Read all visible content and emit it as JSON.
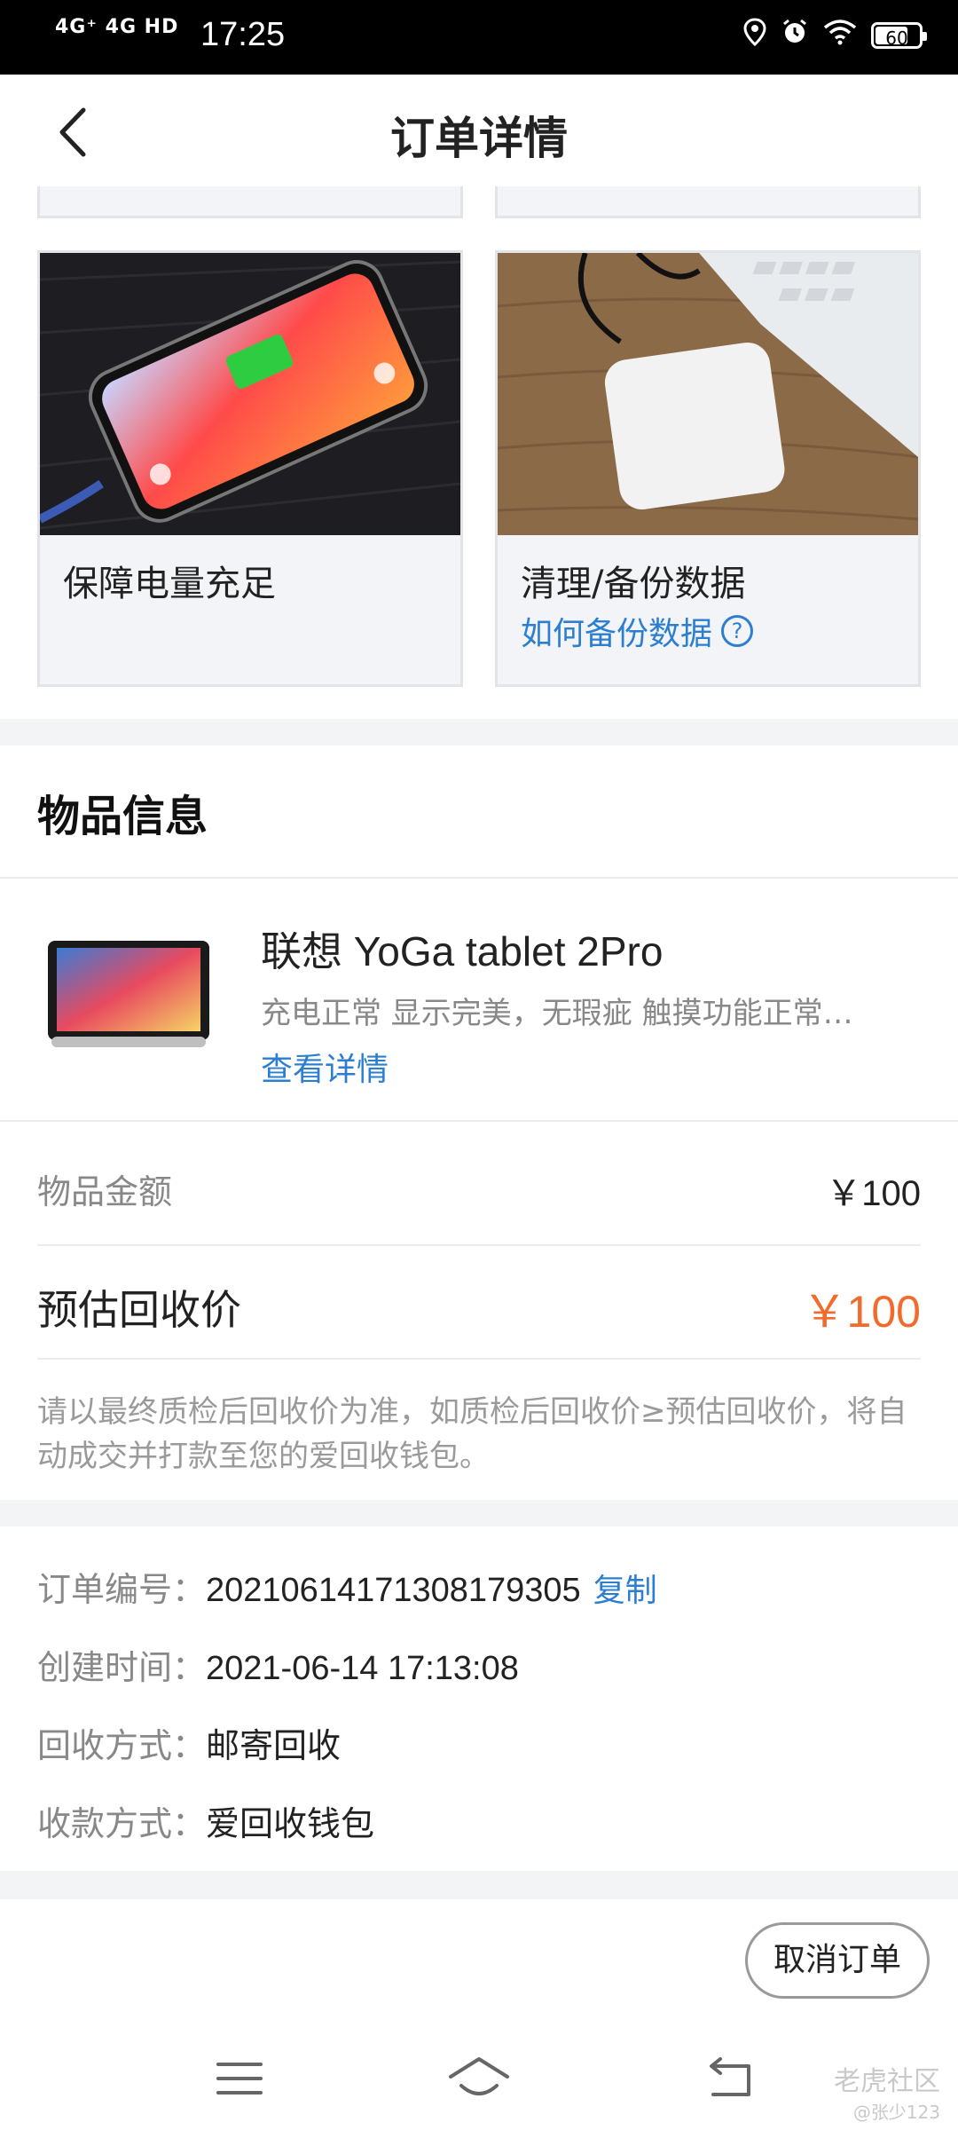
{
  "status_bar": {
    "network": "4G⁺ 4G HD",
    "time": "17:25",
    "battery": "60"
  },
  "header": {
    "title": "订单详情"
  },
  "tips": [
    {
      "title": "保障电量充足",
      "link": ""
    },
    {
      "title": "清理/备份数据",
      "link": "如何备份数据"
    }
  ],
  "item_section": {
    "title": "物品信息",
    "product": {
      "name": "联想 YoGa tablet 2Pro",
      "description": "充电正常 显示完美，无瑕疵 触摸功能正常…",
      "detail_link": "查看详情"
    }
  },
  "pricing": {
    "amount_label": "物品金额",
    "amount_value": "￥100",
    "estimate_label": "预估回收价",
    "estimate_value": "￥100",
    "note": "请以最终质检后回收价为准，如质检后回收价≥预估回收价，将自动成交并打款至您的爱回收钱包。"
  },
  "order_info": {
    "order_no_label": "订单编号：",
    "order_no": "20210614171308179305",
    "copy_label": "复制",
    "created_label": "创建时间：",
    "created_value": "2021-06-14 17:13:08",
    "method_label": "回收方式：",
    "method_value": "邮寄回收",
    "payment_label": "收款方式：",
    "payment_value": "爱回收钱包"
  },
  "actions": {
    "cancel_label": "取消订单"
  },
  "watermark": {
    "site": "老虎社区",
    "user": "@张少123"
  },
  "colors": {
    "accent_link": "#2c7fd0",
    "price_highlight": "#f26a2c"
  },
  "icons": [
    "back-arrow-icon",
    "question-circle-icon",
    "menu-icon",
    "home-icon",
    "return-icon",
    "location-icon",
    "alarm-icon",
    "wifi-icon",
    "battery-icon"
  ]
}
